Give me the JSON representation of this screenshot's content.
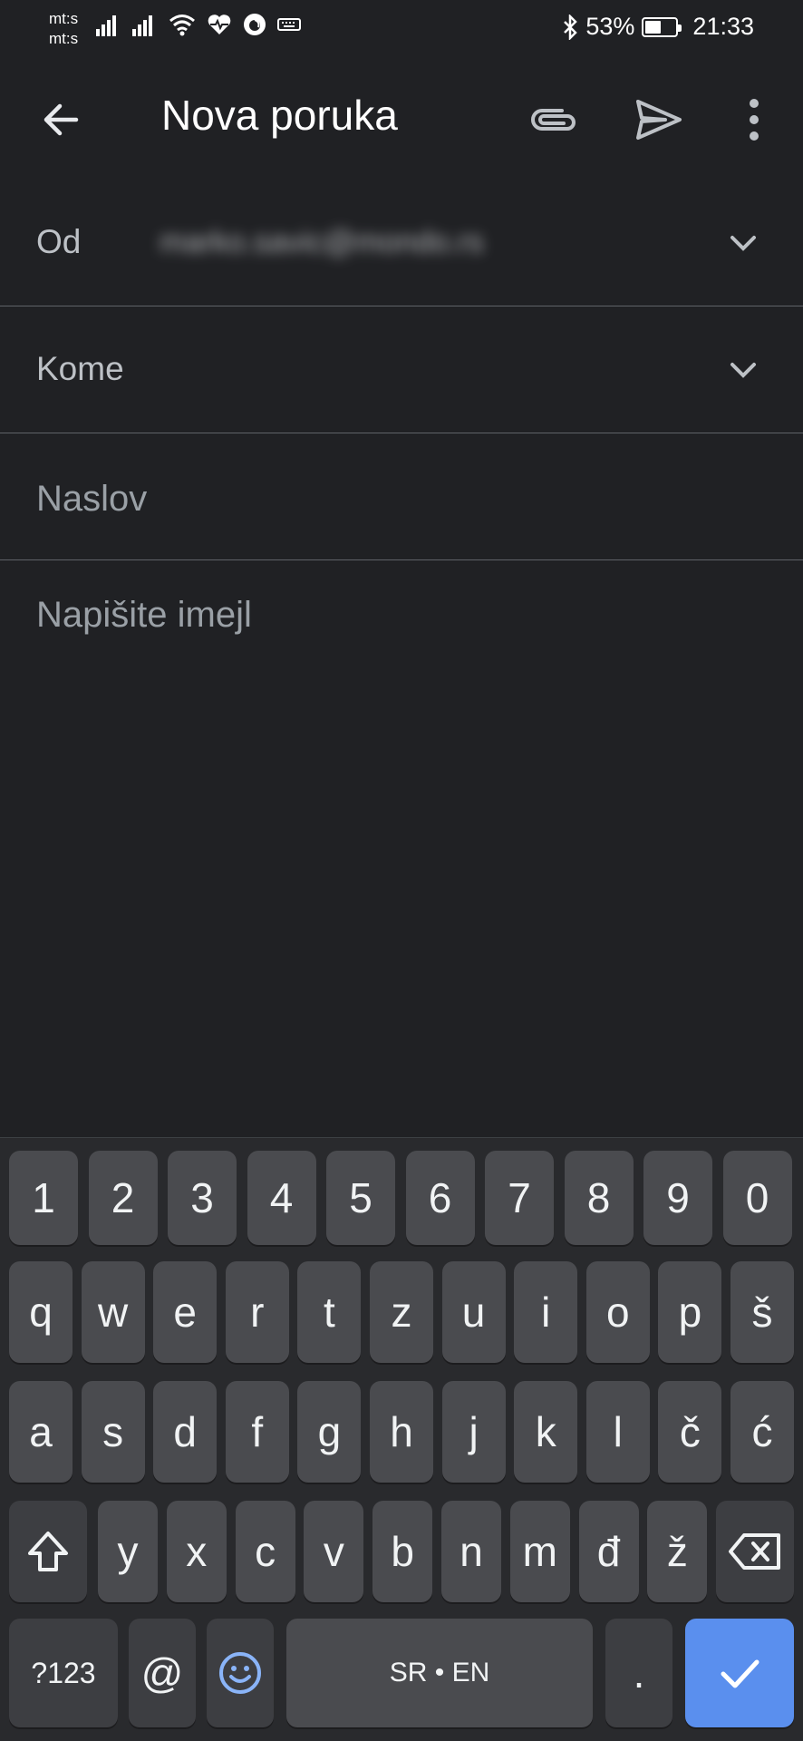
{
  "status_bar": {
    "carrier1": "mt:s",
    "carrier2": "mt:s",
    "battery_percent": "53%",
    "battery_level": 0.53,
    "time": "21:33",
    "icons": [
      "signal-icon",
      "signal-icon",
      "wifi-icon",
      "health-heart-icon",
      "firefox-icon",
      "keyboard-icon",
      "bluetooth-icon",
      "battery-icon"
    ]
  },
  "app_bar": {
    "title": "Nova poruka",
    "icons": [
      "back-arrow-icon",
      "paperclip-icon",
      "send-icon",
      "more-vert-icon"
    ]
  },
  "compose": {
    "from_label": "Od",
    "from_value": "marko.savic@mondo.rs",
    "to_label": "Kome",
    "subject_placeholder": "Naslov",
    "body_placeholder": "Napišite imejl"
  },
  "keyboard": {
    "row_numbers": [
      "1",
      "2",
      "3",
      "4",
      "5",
      "6",
      "7",
      "8",
      "9",
      "0"
    ],
    "row1": [
      "q",
      "w",
      "e",
      "r",
      "t",
      "z",
      "u",
      "i",
      "o",
      "p",
      "š"
    ],
    "row2": [
      "a",
      "s",
      "d",
      "f",
      "g",
      "h",
      "j",
      "k",
      "l",
      "č",
      "ć"
    ],
    "row3": [
      "y",
      "x",
      "c",
      "v",
      "b",
      "n",
      "m",
      "đ",
      "ž"
    ],
    "symbols_label": "?123",
    "at_label": "@",
    "space_label": "SR • EN",
    "period_label": ".",
    "accent_color": "#5a8fee"
  }
}
